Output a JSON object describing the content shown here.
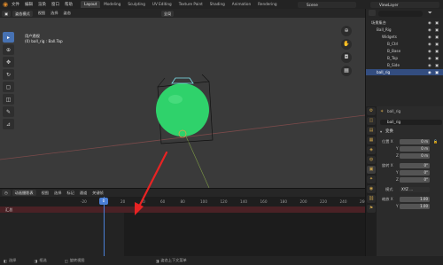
{
  "menu": {
    "file": "文件",
    "edit": "编辑",
    "render": "渲染",
    "window": "窗口",
    "help": "帮助"
  },
  "workspaces": [
    "Layout",
    "Modeling",
    "Sculpting",
    "UV Editing",
    "Texture Paint",
    "Shading",
    "Animation",
    "Rendering"
  ],
  "active_workspace": "Layout",
  "scene_field": "Scene",
  "view_layer_field": "ViewLayer",
  "viewport_header": {
    "mode": "姿态模式",
    "view": "视图",
    "select": "选择",
    "pose": "姿态",
    "global": "全局"
  },
  "viewport_info": {
    "line1": "用户透视",
    "line2": "(0) ball_rig : Ball.Top"
  },
  "timeline_header": {
    "playback": "动画摄影表",
    "view": "视图",
    "select": "选择",
    "marker": "标记",
    "channel": "通道",
    "key": "关键帧"
  },
  "timeline": {
    "ticks": [
      "-20",
      "0",
      "20",
      "40",
      "60",
      "80",
      "100",
      "120",
      "140",
      "160",
      "180",
      "200",
      "220",
      "240",
      "260"
    ],
    "current_frame": "0",
    "summary": "汇总"
  },
  "status_bar": {
    "select": "选择",
    "box_select": "框选",
    "rotate_view": "旋转视图",
    "context_menu": "姿态上下文菜单"
  },
  "outliner": {
    "search_placeholder": "",
    "items": [
      {
        "label": "场景集合",
        "indent": 0
      },
      {
        "label": "Ball_Rig",
        "indent": 1
      },
      {
        "label": "Widgets",
        "indent": 2
      },
      {
        "label": "B_Ctrl",
        "indent": 3
      },
      {
        "label": "B_Base",
        "indent": 3
      },
      {
        "label": "B_Top",
        "indent": 3
      },
      {
        "label": "B_Side",
        "indent": 3
      },
      {
        "label": "ball_rig",
        "indent": 1
      }
    ]
  },
  "properties": {
    "object_name": "ball_rig",
    "object_field": "ball_rig",
    "transform_title": "变换",
    "location": {
      "label": "位置 X",
      "y": "Y",
      "z": "Z",
      "x_val": "0 m",
      "y_val": "0 m",
      "z_val": "0 m"
    },
    "rotation": {
      "label": "旋转 X",
      "y": "Y",
      "z": "Z",
      "x_val": "0°",
      "y_val": "0°",
      "z_val": "0°"
    },
    "mode": {
      "label": "模式",
      "value": "XYZ ..."
    },
    "scale": {
      "label": "缩放 X",
      "y": "Y",
      "x_val": "1.00",
      "y_val": "1.00"
    }
  },
  "colors": {
    "accent": "#4772b3",
    "ball": "#2fd26b",
    "summary_row": "#4a2125",
    "arrow": "#e82323",
    "playhead": "#4a7fd6"
  }
}
